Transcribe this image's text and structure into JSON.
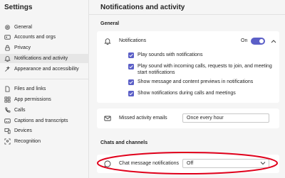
{
  "sidebar": {
    "title": "Settings",
    "groups": [
      [
        {
          "label": "General",
          "icon": "gear-icon"
        },
        {
          "label": "Accounts and orgs",
          "icon": "accounts-icon"
        },
        {
          "label": "Privacy",
          "icon": "lock-icon"
        },
        {
          "label": "Notifications and activity",
          "icon": "bell-icon",
          "active": true
        },
        {
          "label": "Appearance and accessibility",
          "icon": "paint-icon"
        }
      ],
      [
        {
          "label": "Files and links",
          "icon": "file-icon"
        },
        {
          "label": "App permissions",
          "icon": "apps-icon"
        },
        {
          "label": "Calls",
          "icon": "phone-icon"
        },
        {
          "label": "Captions and transcripts",
          "icon": "captions-icon"
        },
        {
          "label": "Devices",
          "icon": "devices-icon"
        },
        {
          "label": "Recognition",
          "icon": "recognition-icon"
        }
      ]
    ]
  },
  "main": {
    "title": "Notifications and activity",
    "general": {
      "heading": "General",
      "notifications_label": "Notifications",
      "notifications_state": "On",
      "checkboxes": [
        "Play sounds with notifications",
        "Play sound with incoming calls, requests to join, and meeting start notifications",
        "Show message and content previews in notifications",
        "Show notifications during calls and meetings"
      ],
      "missed_label": "Missed activity emails",
      "missed_value": "Once every hour"
    },
    "chats": {
      "heading": "Chats and channels",
      "chat_label": "Chat message notifications",
      "chat_value": "Off"
    }
  },
  "colors": {
    "accent": "#5b5fc7",
    "annotation": "#e0001b"
  }
}
